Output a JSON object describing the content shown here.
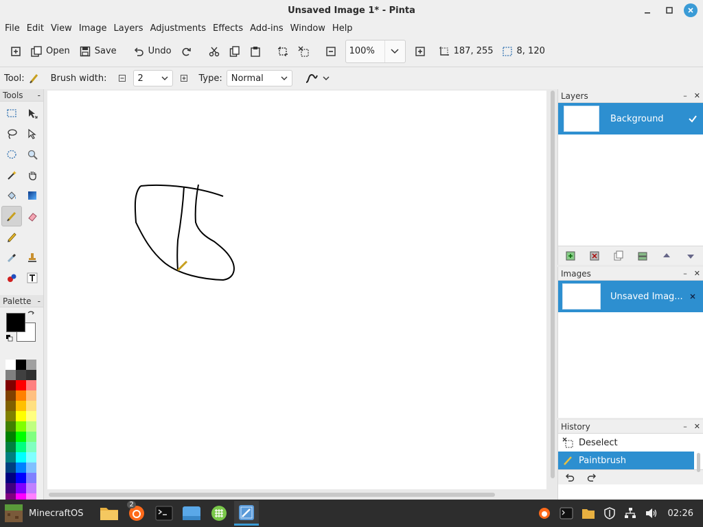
{
  "window": {
    "title": "Unsaved Image 1* - Pinta"
  },
  "menu": [
    "File",
    "Edit",
    "View",
    "Image",
    "Layers",
    "Adjustments",
    "Effects",
    "Add-ins",
    "Window",
    "Help"
  ],
  "toolbar": {
    "open_label": "Open",
    "save_label": "Save",
    "undo_label": "Undo",
    "zoom_value": "100%",
    "cursor_position": "187, 255",
    "selection_size": "8, 120"
  },
  "tool_options": {
    "tool_label": "Tool:",
    "brush_width_label": "Brush width:",
    "brush_width_value": "2",
    "type_label": "Type:",
    "type_value": "Normal"
  },
  "tools_panel": {
    "title": "Tools"
  },
  "palette_panel": {
    "title": "Palette",
    "primary_color": "#000000",
    "secondary_color": "#ffffff",
    "swatches": [
      "#ffffff",
      "#000000",
      "#a0a0a0",
      "#808080",
      "#404040",
      "#303030",
      "#800000",
      "#ff0000",
      "#ff8080",
      "#804000",
      "#ff8000",
      "#ffc080",
      "#806000",
      "#ffc000",
      "#ffe080",
      "#808000",
      "#ffff00",
      "#ffff80",
      "#408000",
      "#80ff00",
      "#c0ff80",
      "#008000",
      "#00ff00",
      "#80ff80",
      "#008040",
      "#00ff80",
      "#80ffc0",
      "#008080",
      "#00ffff",
      "#80ffff",
      "#004080",
      "#0080ff",
      "#80c0ff",
      "#000080",
      "#0000ff",
      "#8080ff",
      "#400080",
      "#8000ff",
      "#c080ff",
      "#800080",
      "#ff00ff",
      "#ff80ff"
    ]
  },
  "layers_panel": {
    "title": "Layers",
    "layer_name": "Background"
  },
  "images_panel": {
    "title": "Images",
    "image_name": "Unsaved Imag..."
  },
  "history_panel": {
    "title": "History",
    "items": [
      "Deselect",
      "Paintbrush"
    ]
  },
  "taskbar": {
    "start_label": "MinecraftOS",
    "firefox_badge": "2",
    "clock": "02:26"
  },
  "colors": {
    "accent": "#2d8fd0"
  }
}
